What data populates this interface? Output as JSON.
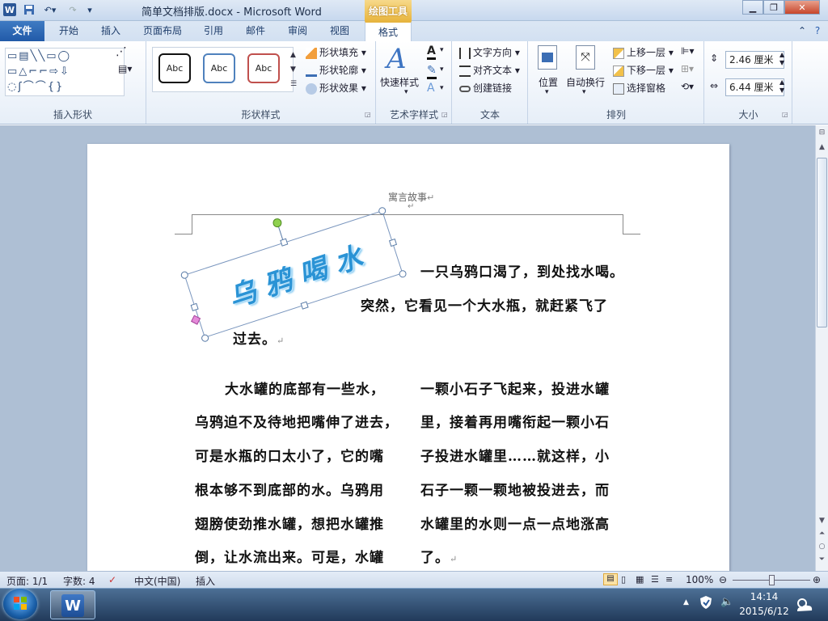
{
  "window": {
    "doc_title": "简单文档排版.docx - Microsoft Word",
    "contextual_header": "绘图工具"
  },
  "tabs": [
    "文件",
    "开始",
    "插入",
    "页面布局",
    "引用",
    "邮件",
    "审阅",
    "视图",
    "格式"
  ],
  "ribbon": {
    "groups": {
      "insert_shapes": "插入形状",
      "shape_styles": "形状样式",
      "wordart_styles": "艺术字样式",
      "text": "文本",
      "arrange": "排列",
      "size": "大小"
    },
    "shape_style_samples": [
      "Abc",
      "Abc",
      "Abc"
    ],
    "shape_fill": "形状填充",
    "shape_outline": "形状轮廓",
    "shape_effects": "形状效果",
    "quick_styles": "快速样式",
    "text_direction": "文字方向",
    "align_text": "对齐文本",
    "create_link": "创建链接",
    "position": "位置",
    "wrap_text": "自动换行",
    "bring_forward": "上移一层",
    "send_backward": "下移一层",
    "selection_pane": "选择窗格",
    "height_value": "2.46 厘米",
    "width_value": "6.44 厘米"
  },
  "document": {
    "header_text": "寓言故事",
    "wordart_text": "乌 鸦 喝 水",
    "line1": "一只乌鸦口渴了，到处找水喝。",
    "line2": "突然，它看见一个大水瓶，就赶紧飞了",
    "line3": "过去。",
    "col1": [
      "大水罐的底部有一些水，",
      "乌鸦迫不及待地把嘴伸了进去，",
      "可是水瓶的口太小了，它的嘴",
      "根本够不到底部的水。乌鸦用",
      "翅膀使劲推水罐，想把水罐推",
      "倒，让水流出来。可是，水罐"
    ],
    "col2": [
      "一颗小石子飞起来，投进水罐",
      "里，接着再用嘴衔起一颗小石",
      "子投进水罐里……就这样，小",
      "石子一颗一颗地被投进去，而",
      "水罐里的水则一点一点地涨高",
      "了。"
    ]
  },
  "status": {
    "page": "页面: 1/1",
    "words": "字数: 4",
    "language": "中文(中国)",
    "mode": "插入",
    "zoom": "100%"
  },
  "taskbar": {
    "time": "14:14",
    "date": "2015/6/12"
  }
}
